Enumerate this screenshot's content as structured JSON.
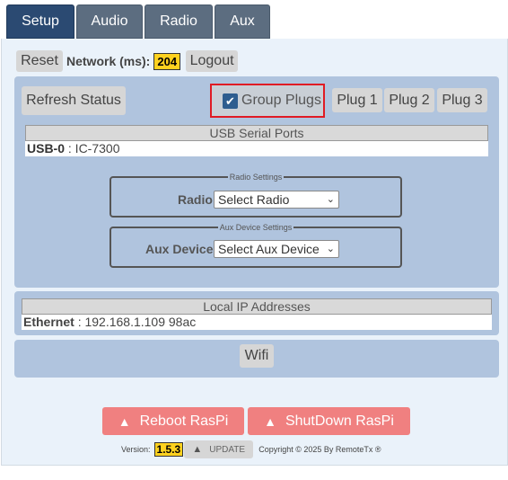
{
  "tabs": [
    {
      "label": "Setup",
      "active": true
    },
    {
      "label": "Audio",
      "active": false
    },
    {
      "label": "Radio",
      "active": false
    },
    {
      "label": "Aux",
      "active": false
    }
  ],
  "topbar": {
    "reset_label": "Reset",
    "network_label": "Network (ms):",
    "network_value": "204",
    "logout_label": "Logout"
  },
  "status": {
    "refresh_label": "Refresh Status",
    "group_plugs_label": "Group Plugs",
    "group_plugs_checked": true,
    "plugs": [
      "Plug 1",
      "Plug 2",
      "Plug 3"
    ]
  },
  "usb_ports": {
    "header": "USB Serial Ports",
    "rows": [
      {
        "port": "USB-0",
        "device": ": IC-7300"
      }
    ]
  },
  "radio_settings": {
    "legend": "Radio Settings",
    "label": "Radio",
    "selected": "Select Radio"
  },
  "aux_settings": {
    "legend": "Aux Device Settings",
    "label": "Aux Device",
    "selected": "Select Aux Device"
  },
  "ip_addresses": {
    "header": "Local IP Addresses",
    "rows": [
      {
        "iface": "Ethernet",
        "address": ": 192.168.1.109 98ac"
      }
    ]
  },
  "wifi_label": "Wifi",
  "actions": {
    "reboot_label": "Reboot RasPi",
    "shutdown_label": "ShutDown RasPi"
  },
  "footer": {
    "version_label": "Version:",
    "version_value": "1.5.3",
    "update_label": "UPDATE",
    "copyright": "Copyright © 2025 By RemoteTx ®"
  },
  "colors": {
    "active_tab": "#2b4a72",
    "tab": "#5c6d80",
    "section": "#b0c4de",
    "badge": "#ffd21f",
    "danger": "#f08080",
    "highlight": "#e01b24"
  }
}
